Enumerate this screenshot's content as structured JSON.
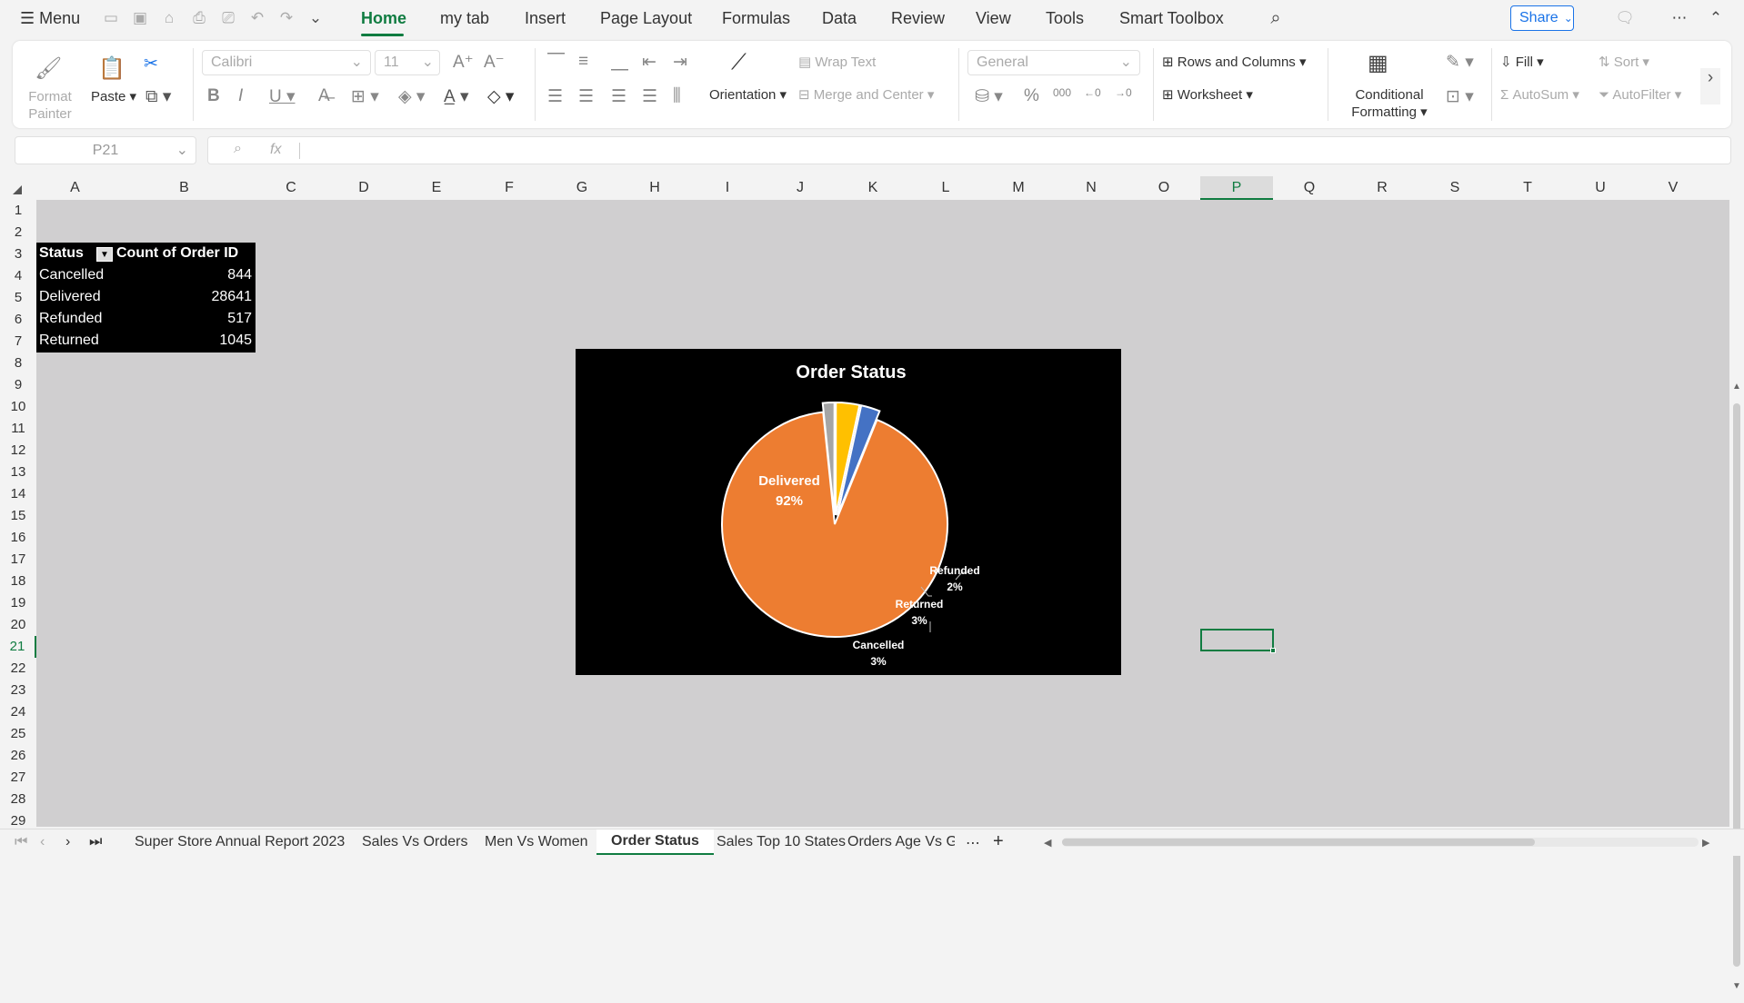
{
  "menubar": {
    "menu_label": "Menu",
    "tabs": [
      "Home",
      "my tab",
      "Insert",
      "Page Layout",
      "Formulas",
      "Data",
      "Review",
      "View",
      "Tools",
      "Smart Toolbox"
    ],
    "share_label": "Share"
  },
  "ribbon": {
    "format_painter": "Format Painter",
    "paste": "Paste",
    "font_name": "Calibri",
    "font_size": "11",
    "orientation": "Orientation",
    "wrap_text": "Wrap Text",
    "merge_center": "Merge and Center",
    "number_format": "General",
    "rows_columns": "Rows and Columns",
    "worksheet": "Worksheet",
    "conditional_formatting": "Conditional Formatting",
    "fill": "Fill",
    "sort": "Sort",
    "autosum": "AutoSum",
    "autofilter": "AutoFilter"
  },
  "formula_bar": {
    "name_box": "P21",
    "fx": "fx",
    "formula": ""
  },
  "columns": [
    "A",
    "B",
    "C",
    "D",
    "E",
    "F",
    "G",
    "H",
    "I",
    "J",
    "K",
    "L",
    "M",
    "N",
    "O",
    "P",
    "Q",
    "R",
    "S",
    "T",
    "U",
    "V"
  ],
  "rows": [
    "1",
    "2",
    "3",
    "4",
    "5",
    "6",
    "7",
    "8",
    "9",
    "10",
    "11",
    "12",
    "13",
    "14",
    "15",
    "16",
    "17",
    "18",
    "19",
    "20",
    "21",
    "22",
    "23",
    "24",
    "25",
    "26",
    "27",
    "28",
    "29"
  ],
  "selected_cell": {
    "column": "P",
    "row": "21"
  },
  "pivot": {
    "header_status": "Status",
    "header_count": "Count of Order ID",
    "rows": [
      {
        "status": "Cancelled",
        "count": "844"
      },
      {
        "status": "Delivered",
        "count": "28641"
      },
      {
        "status": "Refunded",
        "count": "517"
      },
      {
        "status": "Returned",
        "count": "1045"
      }
    ]
  },
  "chart_data": {
    "type": "pie",
    "title": "Order Status",
    "categories": [
      "Delivered",
      "Refunded",
      "Returned",
      "Cancelled"
    ],
    "values": [
      28641,
      517,
      1045,
      844
    ],
    "labels": [
      "92%",
      "2%",
      "3%",
      "3%"
    ],
    "colors": [
      "#ed7d31",
      "#a5a5a5",
      "#ffc000",
      "#4472c4"
    ],
    "background": "#000000",
    "exploded": [
      "Refunded",
      "Returned",
      "Cancelled"
    ]
  },
  "sheet_tabs": [
    "Super Store Annual Report 2023",
    "Sales Vs Orders",
    "Men Vs Women",
    "Order Status",
    "Sales Top 10 States",
    "Orders Age Vs Ge"
  ],
  "active_sheet": "Order Status",
  "colors": {
    "accent": "#107c41",
    "share": "#1a73e8"
  }
}
